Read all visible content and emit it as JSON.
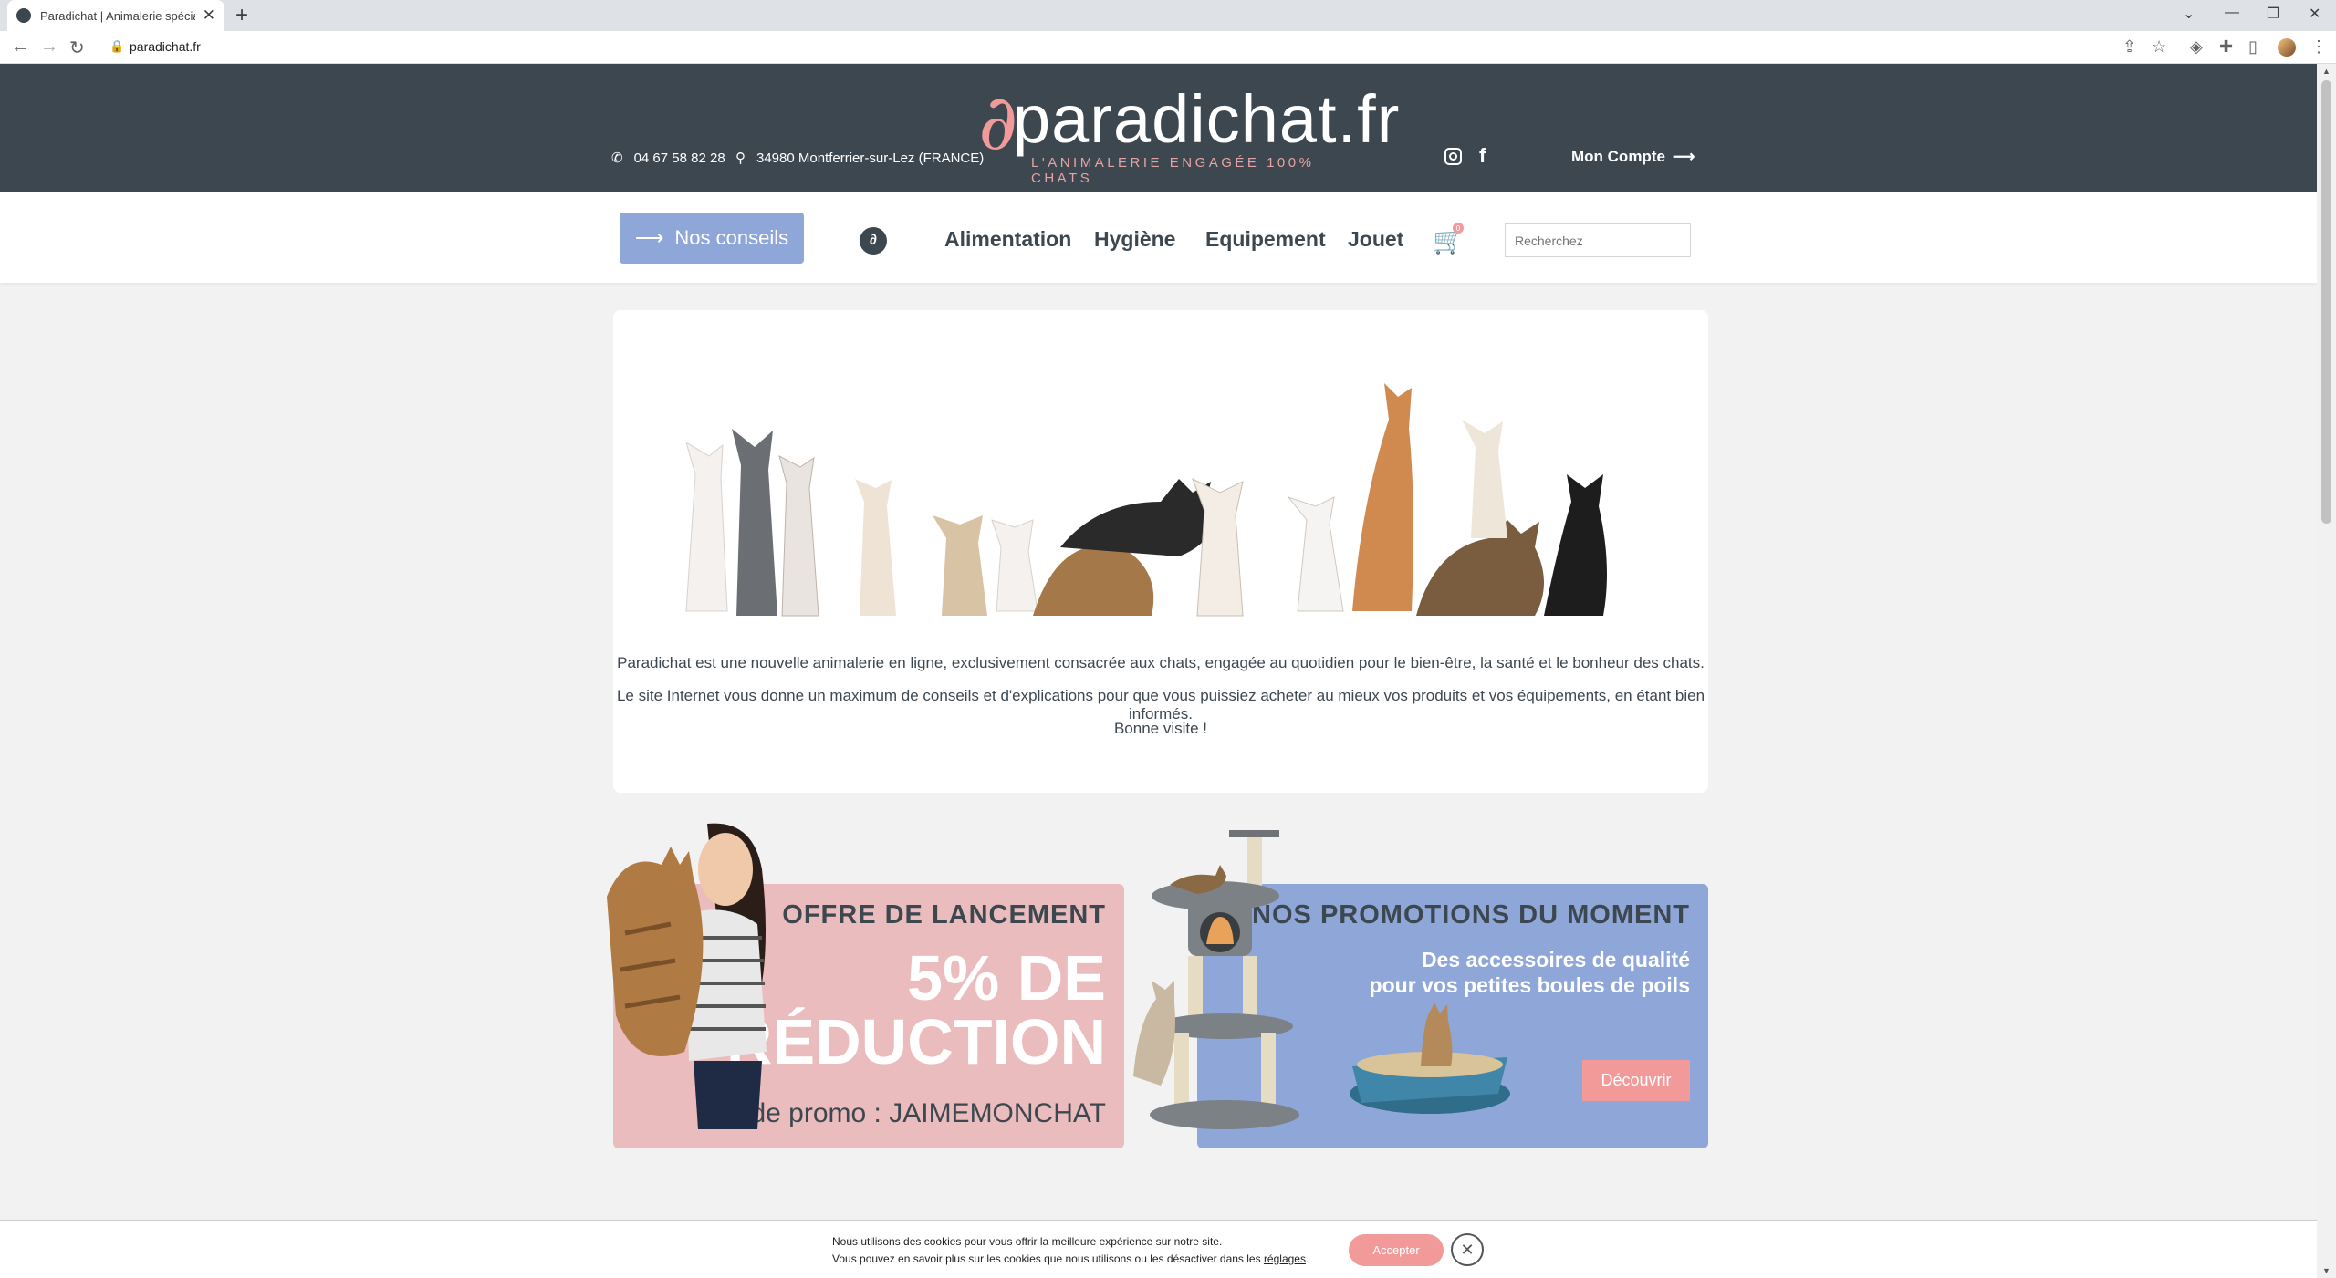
{
  "browser": {
    "tab_title": "Paradichat | Animalerie spécialisée",
    "new_tab": "+",
    "close_tab": "✕",
    "url": "paradichat.fr"
  },
  "header": {
    "phone": "04 67 58 82 28",
    "address": "34980 Montferrier-sur-Lez (FRANCE)",
    "logo_text": "paradichat.fr",
    "tagline": "L'ANIMALERIE ENGAGÉE 100% CHATS",
    "account_label": "Mon Compte",
    "social": [
      "instagram-icon",
      "facebook-icon"
    ]
  },
  "nav": {
    "conseils_label": "Nos conseils",
    "items": [
      "Alimentation",
      "Hygiène",
      "Equipement",
      "Jouet"
    ],
    "cart_count": "0",
    "search_placeholder": "Recherchez"
  },
  "intro": {
    "line1": "Paradichat est une nouvelle animalerie en ligne, exclusivement consacrée aux chats, engagée au quotidien pour le bien-être, la santé et le bonheur des chats.",
    "line2": "Le site Internet vous donne un maximum de conseils et d'explications pour que vous puissiez acheter au mieux vos produits et vos équipements, en étant bien informés.",
    "line3": "Bonne visite !"
  },
  "promo_launch": {
    "label": "OFFRE DE LANCEMENT",
    "big_line1": "5% DE",
    "big_line2": "RÉDUCTION",
    "code": "Code promo : JAIMEMONCHAT"
  },
  "promo_moment": {
    "title": "NOS PROMOTIONS DU MOMENT",
    "sub_line1": "Des accessoires de qualité",
    "sub_line2": "pour vos petites boules de poils",
    "button": "Découvrir"
  },
  "cookie": {
    "line1": "Nous utilisons des cookies pour vous offrir la meilleure expérience sur notre site.",
    "line2_prefix": "Vous pouvez en savoir plus sur les cookies que nous utilisons ou les désactiver dans les ",
    "link": "réglages",
    "line2_suffix": ".",
    "accept": "Accepter"
  },
  "colors": {
    "header_bg": "#3d4750",
    "accent_pink": "#f29a9a",
    "accent_blue": "#8fa6d9",
    "promo_pink_bg": "#ebbcbd"
  }
}
